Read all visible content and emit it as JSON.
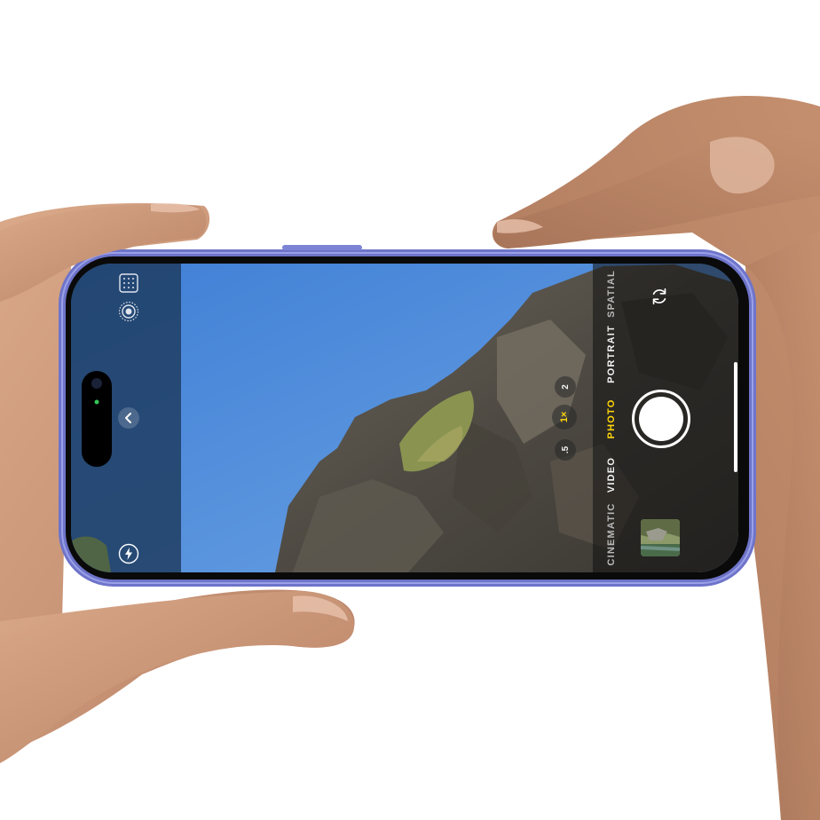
{
  "camera": {
    "modes": {
      "spatial": "SPATIAL",
      "portrait": "PORTRAIT",
      "photo": "PHOTO",
      "video": "VIDEO",
      "cinematic": "CINEMATIC"
    },
    "active_mode": "PHOTO",
    "zoom_levels": {
      "two": "2",
      "one": "1×",
      "half": ".5"
    },
    "active_zoom": "1×",
    "accent_color": "#ffd60a"
  },
  "icons": {
    "grid": "grid-icon",
    "live_photo": "live-photo-icon",
    "chevron": "chevron-left-icon",
    "flash": "flash-icon",
    "flip": "flip-camera-icon"
  },
  "colors": {
    "phone_frame": "#6e74c9",
    "sky": "#4a86d6",
    "skin": "#c99674"
  }
}
